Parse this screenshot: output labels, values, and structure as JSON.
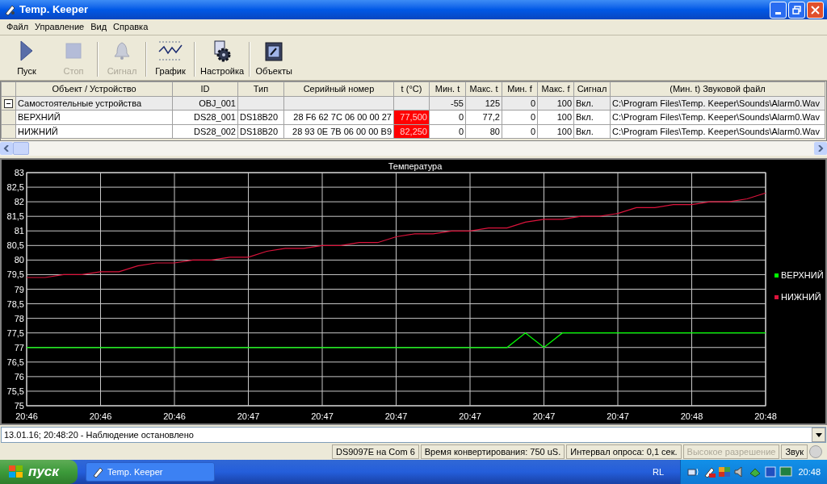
{
  "window": {
    "title": "Temp. Keeper"
  },
  "menu": [
    "Файл",
    "Управление",
    "Вид",
    "Справка"
  ],
  "toolbar": [
    {
      "label": "Пуск",
      "disabled": false
    },
    {
      "label": "Стоп",
      "disabled": true
    },
    {
      "label": "Сигнал",
      "disabled": true
    },
    {
      "label": "График",
      "disabled": false
    },
    {
      "label": "Настройка",
      "disabled": false
    },
    {
      "label": "Объекты",
      "disabled": false
    }
  ],
  "table": {
    "columns": [
      "Объект / Устройство",
      "ID",
      "Тип",
      "Серийный номер",
      "t (°C)",
      "Мин. t",
      "Макс. t",
      "Мин. f",
      "Макс. f",
      "Сигнал",
      "(Мин. t) Звуковой файл"
    ],
    "rows": [
      {
        "kind": "group",
        "expanded": true,
        "name": "Самостоятельные устройства",
        "id": "OBJ_001",
        "min_t": "-55",
        "max_t": "125",
        "min_f": "0",
        "max_f": "100",
        "signal": "Вкл.",
        "sound_file": "C:\\Program Files\\Temp. Keeper\\Sounds\\Alarm0.Wav"
      },
      {
        "kind": "device",
        "name": "ВЕРХНИЙ",
        "id": "DS28_001",
        "type": "DS18B20",
        "serial": "28 F6 62 7C 06 00 00 27",
        "t": "77,500",
        "alarm": true,
        "min_t": "0",
        "max_t": "77,2",
        "min_f": "0",
        "max_f": "100",
        "signal": "Вкл.",
        "sound_file": "C:\\Program Files\\Temp. Keeper\\Sounds\\Alarm0.Wav"
      },
      {
        "kind": "device",
        "name": "НИЖНИЙ",
        "id": "DS28_002",
        "type": "DS18B20",
        "serial": "28 93 0E 7B 06 00 00 B9",
        "t": "82,250",
        "alarm": true,
        "min_t": "0",
        "max_t": "80",
        "min_f": "0",
        "max_f": "100",
        "signal": "Вкл.",
        "sound_file": "C:\\Program Files\\Temp. Keeper\\Sounds\\Alarm0.Wav"
      }
    ]
  },
  "chart": {
    "chart_data": {
      "type": "line",
      "title": "Температура",
      "categories": [
        "20:46",
        null,
        null,
        null,
        "20:46",
        null,
        null,
        null,
        "20:46",
        null,
        null,
        null,
        "20:47",
        null,
        null,
        null,
        "20:47",
        null,
        null,
        null,
        "20:47",
        null,
        null,
        null,
        "20:47",
        null,
        null,
        null,
        "20:47",
        null,
        null,
        null,
        "20:47",
        null,
        null,
        null,
        "20:48",
        null,
        null,
        null,
        "20:48"
      ],
      "series": [
        {
          "name": "ВЕРХНИЙ",
          "color": "#00ff00",
          "values": [
            77,
            77,
            77,
            77,
            77,
            77,
            77,
            77,
            77,
            77,
            77,
            77,
            77,
            77,
            77,
            77,
            77,
            77,
            77,
            77,
            77,
            77,
            77,
            77,
            77,
            77,
            77,
            77.5,
            77,
            77.5,
            77.5,
            77.5,
            77.5,
            77.5,
            77.5,
            77.5,
            77.5,
            77.5,
            77.5,
            77.5,
            77.5
          ]
        },
        {
          "name": "НИЖНИЙ",
          "color": "#dc143c",
          "values": [
            79.4,
            79.4,
            79.5,
            79.5,
            79.6,
            79.6,
            79.8,
            79.9,
            79.9,
            80,
            80,
            80.1,
            80.1,
            80.3,
            80.4,
            80.4,
            80.5,
            80.5,
            80.6,
            80.6,
            80.8,
            80.9,
            80.9,
            81,
            81,
            81.1,
            81.1,
            81.3,
            81.4,
            81.4,
            81.5,
            81.5,
            81.6,
            81.8,
            81.8,
            81.9,
            81.9,
            82,
            82,
            82.1,
            82.3
          ]
        }
      ],
      "ylim": [
        75,
        83
      ],
      "grid": true,
      "legend": true,
      "yticks": [
        {
          "value": 75,
          "label": "75"
        },
        {
          "value": 75.5,
          "label": "75,5"
        },
        {
          "value": 76,
          "label": "76"
        },
        {
          "value": 76.5,
          "label": "76,5"
        },
        {
          "value": 77,
          "label": "77"
        },
        {
          "value": 77.5,
          "label": "77,5"
        },
        {
          "value": 78,
          "label": "78"
        },
        {
          "value": 78.5,
          "label": "78,5"
        },
        {
          "value": 79,
          "label": "79"
        },
        {
          "value": 79.5,
          "label": "79,5"
        },
        {
          "value": 80,
          "label": "80"
        },
        {
          "value": 80.5,
          "label": "80,5"
        },
        {
          "value": 81,
          "label": "81"
        },
        {
          "value": 81.5,
          "label": "81,5"
        },
        {
          "value": 82,
          "label": "82"
        },
        {
          "value": 82.5,
          "label": "82,5"
        },
        {
          "value": 83,
          "label": "83"
        }
      ]
    }
  },
  "log": {
    "value": "13.01.16; 20:48:20 - Наблюдение остановлено"
  },
  "status_bar": [
    {
      "text": "DS9097E на Com 6",
      "disabled": false
    },
    {
      "text": "Время конвертирования: 750 uS.",
      "disabled": false
    },
    {
      "text": "Интервал опроса: 0,1 сек.",
      "disabled": false
    },
    {
      "text": "Высокое разрешение",
      "disabled": true
    },
    {
      "text": "Звук",
      "disabled": false
    }
  ],
  "taskbar": {
    "start": "пуск",
    "tasks": [
      {
        "label": "Temp. Keeper",
        "selected": false
      }
    ],
    "language": "RL",
    "clock": "20:48"
  }
}
